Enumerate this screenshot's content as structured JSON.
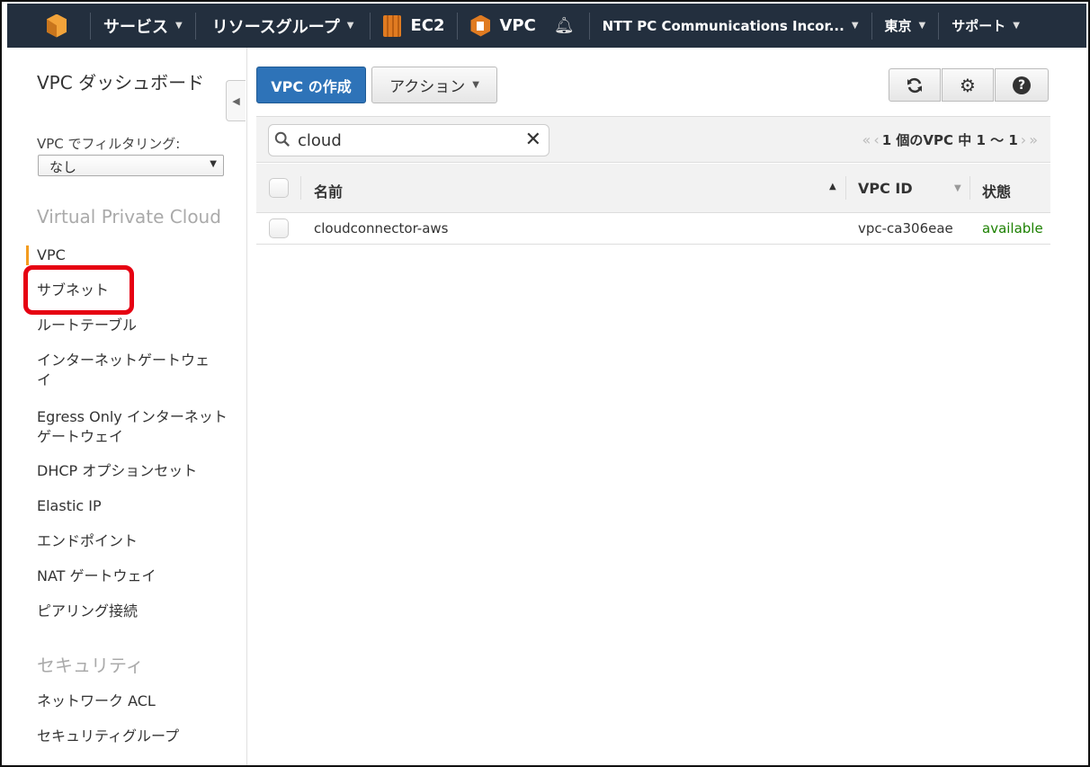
{
  "topnav": {
    "services": "サービス",
    "resource_groups": "リソースグループ",
    "ec2": "EC2",
    "vpc": "VPC",
    "account": "NTT PC Communications Incor...",
    "region": "東京",
    "support": "サポート"
  },
  "sidebar": {
    "title": "VPC ダッシュボード",
    "filter_label": "VPC でフィルタリング:",
    "filter_value": "なし",
    "sections": {
      "vpc": "Virtual Private Cloud",
      "security": "セキュリティ"
    },
    "items": [
      "VPC",
      "サブネット",
      "ルートテーブル",
      "インターネットゲートウェイ",
      "Egress Only インターネットゲートウェイ",
      "DHCP オプションセット",
      "Elastic IP",
      "エンドポイント",
      "NAT ゲートウェイ",
      "ピアリング接続"
    ],
    "security_items": [
      "ネットワーク ACL",
      "セキュリティグループ"
    ]
  },
  "main": {
    "create_button": "VPC の作成",
    "actions_button": "アクション",
    "search_value": "cloud",
    "pager": {
      "first": "«",
      "prev": "‹",
      "text": "1 個のVPC 中 1 ～ 1",
      "next": "›",
      "last": "»"
    },
    "columns": [
      "名前",
      "VPC ID",
      "状態"
    ],
    "rows": [
      {
        "name": "cloudconnector-aws",
        "vpc_id": "vpc-ca306eae",
        "state": "available"
      }
    ]
  },
  "colors": {
    "nav_bg": "#232f3e",
    "primary": "#2e73b8",
    "status_ok": "#1d8102",
    "highlight": "#e60012"
  }
}
